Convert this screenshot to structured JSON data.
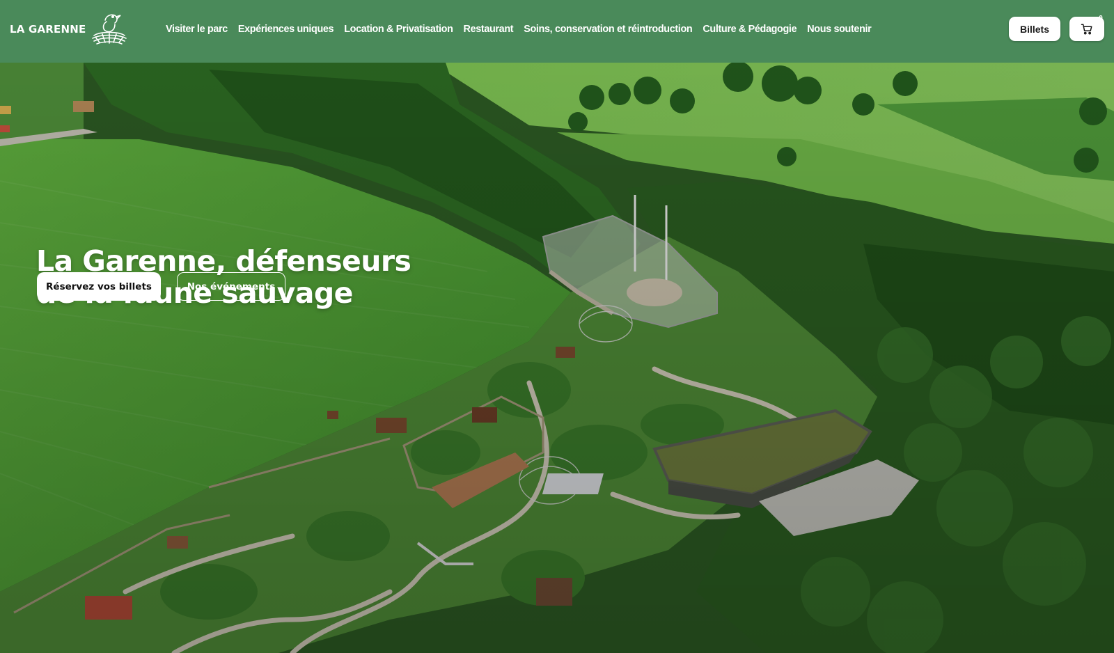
{
  "header": {
    "logo_text": "LA GARENNE",
    "logo_icon": "nest-bird-logo-icon",
    "nav": [
      {
        "label": "Visiter le parc"
      },
      {
        "label": "Expériences uniques"
      },
      {
        "label": "Location & Privatisation"
      },
      {
        "label": "Restaurant"
      },
      {
        "label": "Soins, conservation et réintroduction"
      },
      {
        "label": "Culture & Pédagogie"
      },
      {
        "label": "Nous soutenir"
      }
    ],
    "tickets_label": "Billets",
    "cart_icon": "cart-icon",
    "cart_count": "0"
  },
  "hero": {
    "title_line1": "La Garenne, défenseurs",
    "title_line2": "de la faune sauvage",
    "cta_primary": "Réservez vos billets",
    "cta_secondary": "Nos événements"
  },
  "colors": {
    "header_bg": "#4a8a5a",
    "text_light": "#ffffff",
    "button_bg": "#ffffff"
  }
}
